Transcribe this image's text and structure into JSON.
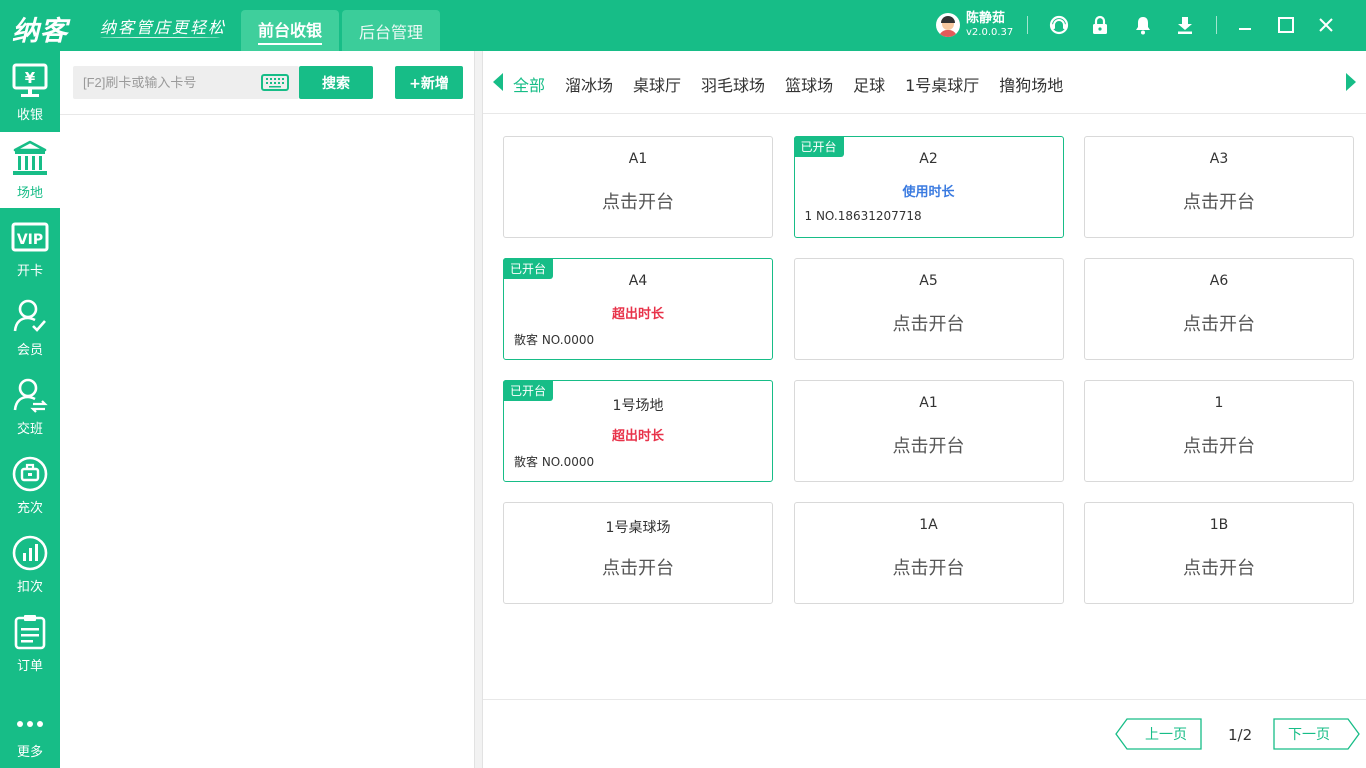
{
  "header": {
    "logo": "纳客",
    "slogan": "纳客管店更轻松",
    "tabs": [
      {
        "label": "前台收银",
        "active": true
      },
      {
        "label": "后台管理",
        "active": false
      }
    ],
    "user": {
      "name": "陈静茹",
      "version": "v2.0.0.37"
    },
    "icons": [
      "support-icon",
      "lock-icon",
      "bell-icon",
      "download-icon",
      "minimize-icon",
      "maximize-icon",
      "close-icon"
    ]
  },
  "sidebar": {
    "items": [
      {
        "label": "收银",
        "icon": "cashier-monitor-icon",
        "active": false
      },
      {
        "label": "场地",
        "icon": "venue-building-icon",
        "active": true
      },
      {
        "label": "开卡",
        "icon": "vip-card-icon",
        "active": false
      },
      {
        "label": "会员",
        "icon": "member-icon",
        "active": false
      },
      {
        "label": "交班",
        "icon": "shift-handover-icon",
        "active": false
      },
      {
        "label": "充次",
        "icon": "recharge-icon",
        "active": false
      },
      {
        "label": "扣次",
        "icon": "deduct-chart-icon",
        "active": false
      },
      {
        "label": "订单",
        "icon": "order-list-icon",
        "active": false
      },
      {
        "label": "更多",
        "icon": "more-dots-icon",
        "active": false
      }
    ]
  },
  "left": {
    "search_placeholder": "[F2]刷卡或输入卡号",
    "search_button": "搜索",
    "add_button": "+新增"
  },
  "categories": [
    "全部",
    "溜冰场",
    "桌球厅",
    "羽毛球场",
    "篮球场",
    "足球",
    "1号桌球厅",
    "撸狗场地"
  ],
  "active_category": "全部",
  "cards": [
    {
      "name": "A1",
      "open": false,
      "action": "点击开台"
    },
    {
      "name": "A2",
      "open": true,
      "badge": "已开台",
      "status": "使用时长",
      "status_color": "blue",
      "member": "1 NO.18631207718"
    },
    {
      "name": "A3",
      "open": false,
      "action": "点击开台"
    },
    {
      "name": "A4",
      "open": true,
      "badge": "已开台",
      "status": "超出时长",
      "status_color": "red",
      "member": "散客 NO.0000"
    },
    {
      "name": "A5",
      "open": false,
      "action": "点击开台"
    },
    {
      "name": "A6",
      "open": false,
      "action": "点击开台"
    },
    {
      "name": "1号场地",
      "open": true,
      "badge": "已开台",
      "status": "超出时长",
      "status_color": "red",
      "member": "散客 NO.0000"
    },
    {
      "name": "A1",
      "open": false,
      "action": "点击开台"
    },
    {
      "name": "1",
      "open": false,
      "action": "点击开台"
    },
    {
      "name": "1号桌球场",
      "open": false,
      "action": "点击开台"
    },
    {
      "name": "1A",
      "open": false,
      "action": "点击开台"
    },
    {
      "name": "1B",
      "open": false,
      "action": "点击开台"
    }
  ],
  "pagination": {
    "prev": "上一页",
    "next": "下一页",
    "page": "1/2"
  },
  "colors": {
    "accent": "#17bd87",
    "blue_status": "#3b7be0",
    "red_status": "#e8334a"
  }
}
